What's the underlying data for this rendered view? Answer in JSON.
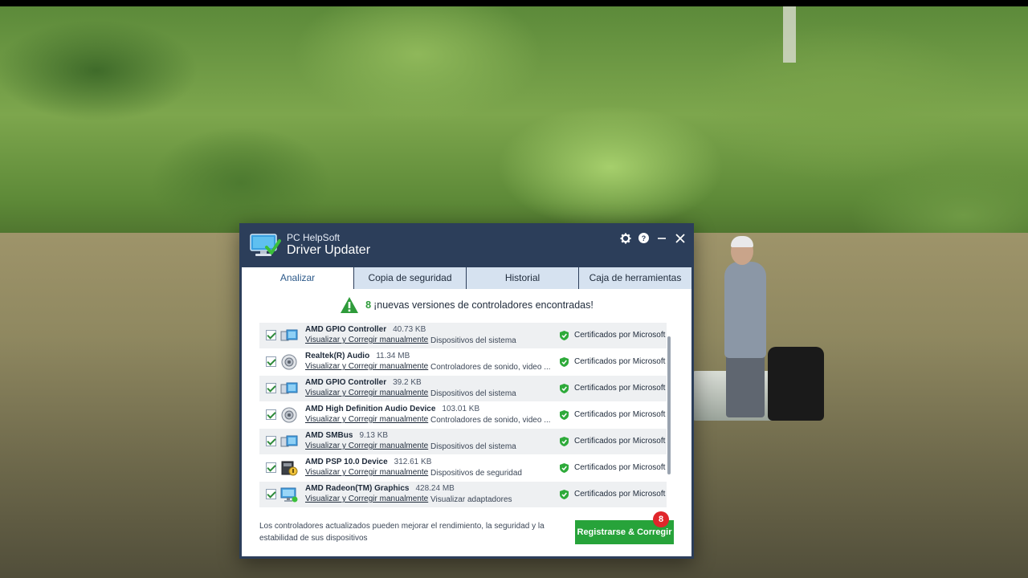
{
  "app": {
    "brand_small": "PC HelpSoft",
    "brand_big": "Driver Updater"
  },
  "tabs": [
    {
      "label": "Analizar",
      "active": true
    },
    {
      "label": "Copia de seguridad",
      "active": false
    },
    {
      "label": "Historial",
      "active": false
    },
    {
      "label": "Caja de herramientas",
      "active": false
    }
  ],
  "scan": {
    "count": "8",
    "message": "¡nuevas versiones de controladores encontradas!"
  },
  "drivers": [
    {
      "name": "AMD GPIO Controller",
      "size": "40.73 KB",
      "link": "Visualizar y Corregir manualmente",
      "category": "Dispositivos del sistema",
      "cert": "Certificados por Microsoft",
      "icon": "system-device-icon",
      "checked": true
    },
    {
      "name": "Realtek(R) Audio",
      "size": "11.34 MB",
      "link": "Visualizar y Corregir manualmente",
      "category": "Controladores de sonido, video ...",
      "cert": "Certificados por Microsoft",
      "icon": "speaker-icon",
      "checked": true
    },
    {
      "name": "AMD GPIO Controller",
      "size": "39.2 KB",
      "link": "Visualizar y Corregir manualmente",
      "category": "Dispositivos del sistema",
      "cert": "Certificados por Microsoft",
      "icon": "system-device-icon",
      "checked": true
    },
    {
      "name": "AMD High Definition Audio Device",
      "size": "103.01 KB",
      "link": "Visualizar y Corregir manualmente",
      "category": "Controladores de sonido, video ...",
      "cert": "Certificados por Microsoft",
      "icon": "speaker-icon",
      "checked": true
    },
    {
      "name": "AMD SMBus",
      "size": "9.13 KB",
      "link": "Visualizar y Corregir manualmente",
      "category": "Dispositivos del sistema",
      "cert": "Certificados por Microsoft",
      "icon": "system-device-icon",
      "checked": true
    },
    {
      "name": "AMD PSP 10.0 Device",
      "size": "312.61 KB",
      "link": "Visualizar y Corregir manualmente",
      "category": "Dispositivos de seguridad",
      "cert": "Certificados por Microsoft",
      "icon": "security-device-icon",
      "checked": true
    },
    {
      "name": "AMD Radeon(TM) Graphics",
      "size": "428.24 MB",
      "link": "Visualizar y Corregir manualmente",
      "category": "Visualizar adaptadores",
      "cert": "Certificados por Microsoft",
      "icon": "display-adapter-icon",
      "checked": true
    }
  ],
  "footer": {
    "text": "Los controladores actualizados pueden mejorar el rendimiento, la seguridad y la estabilidad de sus dispositivos",
    "cta_label": "Registrarse & Corregir",
    "badge": "8"
  },
  "colors": {
    "window_bg": "#2c3e5a",
    "tab_bg": "#d6e2f0",
    "accent_green": "#27a33a",
    "badge_red": "#e0262b",
    "warning_green": "#2e9b3a"
  }
}
